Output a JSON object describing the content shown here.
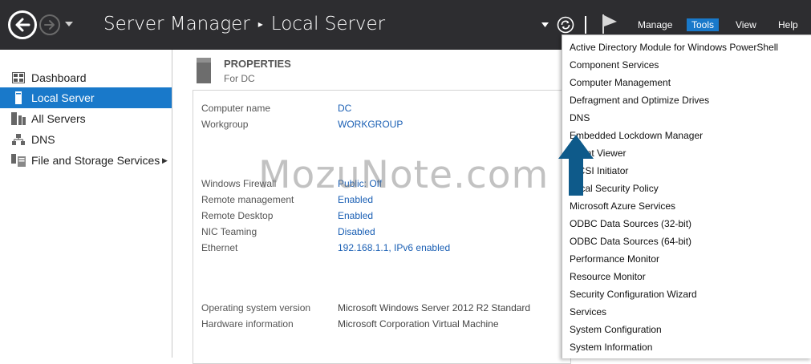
{
  "header": {
    "app_title": "Server Manager",
    "page_title": "Local Server",
    "breadcrumb_separator": "▸",
    "menus": [
      "Manage",
      "Tools",
      "View",
      "Help"
    ],
    "active_menu": "Tools",
    "accent": "#1979ca"
  },
  "sidebar": {
    "items": [
      {
        "label": "Dashboard",
        "icon": "dashboard-icon",
        "selected": false
      },
      {
        "label": "Local Server",
        "icon": "local-server-icon",
        "selected": true
      },
      {
        "label": "All Servers",
        "icon": "all-servers-icon",
        "selected": false
      },
      {
        "label": "DNS",
        "icon": "dns-icon",
        "selected": false
      },
      {
        "label": "File and Storage Services",
        "icon": "file-storage-icon",
        "selected": false,
        "expandable": true
      }
    ]
  },
  "properties": {
    "title": "PROPERTIES",
    "subtitle": "For DC",
    "rows": [
      {
        "label": "Computer name",
        "value": "DC",
        "link": true
      },
      {
        "label": "Workgroup",
        "value": "WORKGROUP",
        "link": true
      },
      {
        "label": "Windows Firewall",
        "value": "Public: Off",
        "link": true
      },
      {
        "label": "Remote management",
        "value": "Enabled",
        "link": true
      },
      {
        "label": "Remote Desktop",
        "value": "Enabled",
        "link": true
      },
      {
        "label": "NIC Teaming",
        "value": "Disabled",
        "link": true
      },
      {
        "label": "Ethernet",
        "value": "192.168.1.1, IPv6 enabled",
        "link": true
      },
      {
        "label": "Operating system version",
        "value": "Microsoft Windows Server 2012 R2 Standard",
        "link": false
      },
      {
        "label": "Hardware information",
        "value": "Microsoft Corporation Virtual Machine",
        "link": false
      }
    ]
  },
  "tools_menu": {
    "items": [
      "Active Directory Module for Windows PowerShell",
      "Component Services",
      "Computer Management",
      "Defragment and Optimize Drives",
      "DNS",
      "Embedded Lockdown Manager",
      "Event Viewer",
      "iSCSI Initiator",
      "Local Security Policy",
      "Microsoft Azure Services",
      "ODBC Data Sources (32-bit)",
      "ODBC Data Sources (64-bit)",
      "Performance Monitor",
      "Resource Monitor",
      "Security Configuration Wizard",
      "Services",
      "System Configuration",
      "System Information"
    ]
  },
  "annotation": {
    "arrow_color": "#0e5a8a"
  },
  "watermark": "MozuNote.com"
}
